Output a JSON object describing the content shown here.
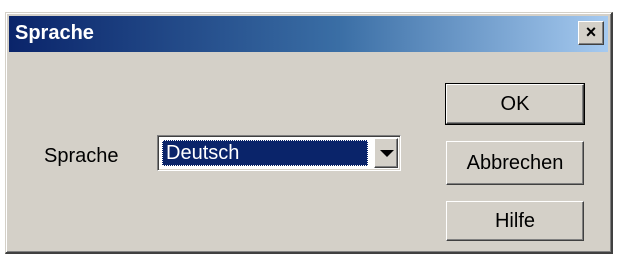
{
  "window": {
    "title": "Sprache",
    "close_label": "×"
  },
  "form": {
    "language_label": "Sprache",
    "language_value": "Deutsch"
  },
  "buttons": {
    "ok": "OK",
    "cancel": "Abbrechen",
    "help": "Hilfe"
  },
  "colors": {
    "face": "#d4d0c8",
    "title_start": "#0a246a",
    "title_end": "#a6caf0",
    "selection": "#0a246a"
  }
}
